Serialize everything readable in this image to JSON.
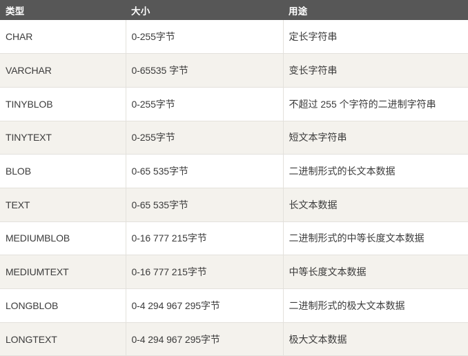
{
  "table": {
    "headers": [
      {
        "id": "type",
        "label": "类型"
      },
      {
        "id": "size",
        "label": "大小"
      },
      {
        "id": "usage",
        "label": "用途"
      }
    ],
    "rows": [
      {
        "type": "CHAR",
        "size": "0-255字节",
        "usage": "定长字符串"
      },
      {
        "type": "VARCHAR",
        "size": "0-65535 字节",
        "usage": "变长字符串"
      },
      {
        "type": "TINYBLOB",
        "size": "0-255字节",
        "usage": "不超过 255 个字符的二进制字符串"
      },
      {
        "type": "TINYTEXT",
        "size": "0-255字节",
        "usage": "短文本字符串"
      },
      {
        "type": "BLOB",
        "size": "0-65 535字节",
        "usage": "二进制形式的长文本数据"
      },
      {
        "type": "TEXT",
        "size": "0-65 535字节",
        "usage": "长文本数据"
      },
      {
        "type": "MEDIUMBLOB",
        "size": "0-16 777 215字节",
        "usage": "二进制形式的中等长度文本数据"
      },
      {
        "type": "MEDIUMTEXT",
        "size": "0-16 777 215字节",
        "usage": "中等长度文本数据"
      },
      {
        "type": "LONGBLOB",
        "size": "0-4 294 967 295字节",
        "usage": "二进制形式的极大文本数据"
      },
      {
        "type": "LONGTEXT",
        "size": "0-4 294 967 295字节",
        "usage": "极大文本数据"
      }
    ]
  },
  "colors": {
    "header_background": "#575757",
    "header_text": "#ffffff",
    "row_odd_background": "#ffffff",
    "row_even_background": "#f4f2ed",
    "cell_text": "#3b3b3b",
    "border": "#e3e1dc"
  }
}
